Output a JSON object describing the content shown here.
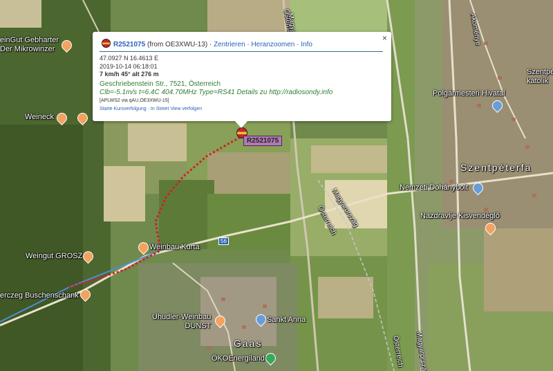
{
  "map": {
    "place_labels": {
      "weingut_gebharter": "einGut Gebharter\nDer Mikrowinzer",
      "weineck": "Weineck",
      "weingut_grosz": "Weingut GROSZ",
      "weinbau_kurta": "Weinbau Kurta",
      "buschenschank": "erczeg Buschenschank",
      "uhudler": "Uhudler-Weinbau\nDUNST",
      "sankt_anna": "Sankt Anna",
      "gaas": "Gaas",
      "oko": "ÖKOEnergiland",
      "polgarmesteri": "Polgármesteri Hivatal",
      "szentpeterfa": "Szentpéterfa",
      "nemzeti": "Nemzeti Dohánybolt",
      "nazdravlje": "Nazdravlje Kisvendéglő",
      "szentpeter_kat": "Szentpé\nkatolik",
      "akoemenyu": "Akoménye"
    },
    "road_labels": {
      "osterreich_1": "Österreich",
      "osterreich_2": "Österreich",
      "osterreich_3": "Österreich",
      "magyarorszag_1": "Magyarország",
      "magyarorszag_2": "Magyarország",
      "magyarorszag_3": "Magyarország",
      "route": "56"
    },
    "marker_label": "R2521075"
  },
  "popup": {
    "close": "×",
    "callsign": "R2521075",
    "from": "(from OE3XWU-13)",
    "sep": " · ",
    "links": [
      "Zentrieren",
      "Heranzoomen",
      "Info"
    ],
    "coords": "47.0927 N 16.4613 E",
    "timestamp": "2019-10-14 06:18:01",
    "speed": "7 km/h 45° alt 276 m",
    "address": "Geschriebenstein Str., 7521, Österreich",
    "comment": "Clb=-5.1m/s t=6.4C 404.70MHz Type=RS41 Details zu http://radiosondy.info",
    "path": "[APLWS2 via qAU,OE3XWU-15]",
    "actions": "Starte Kursverfolgung · In Street View verfolgen"
  },
  "colors": {
    "track": "#d21f2a",
    "path_line": "#4d8fd6",
    "link": "#2a5fb7",
    "address": "#2e7d32"
  }
}
